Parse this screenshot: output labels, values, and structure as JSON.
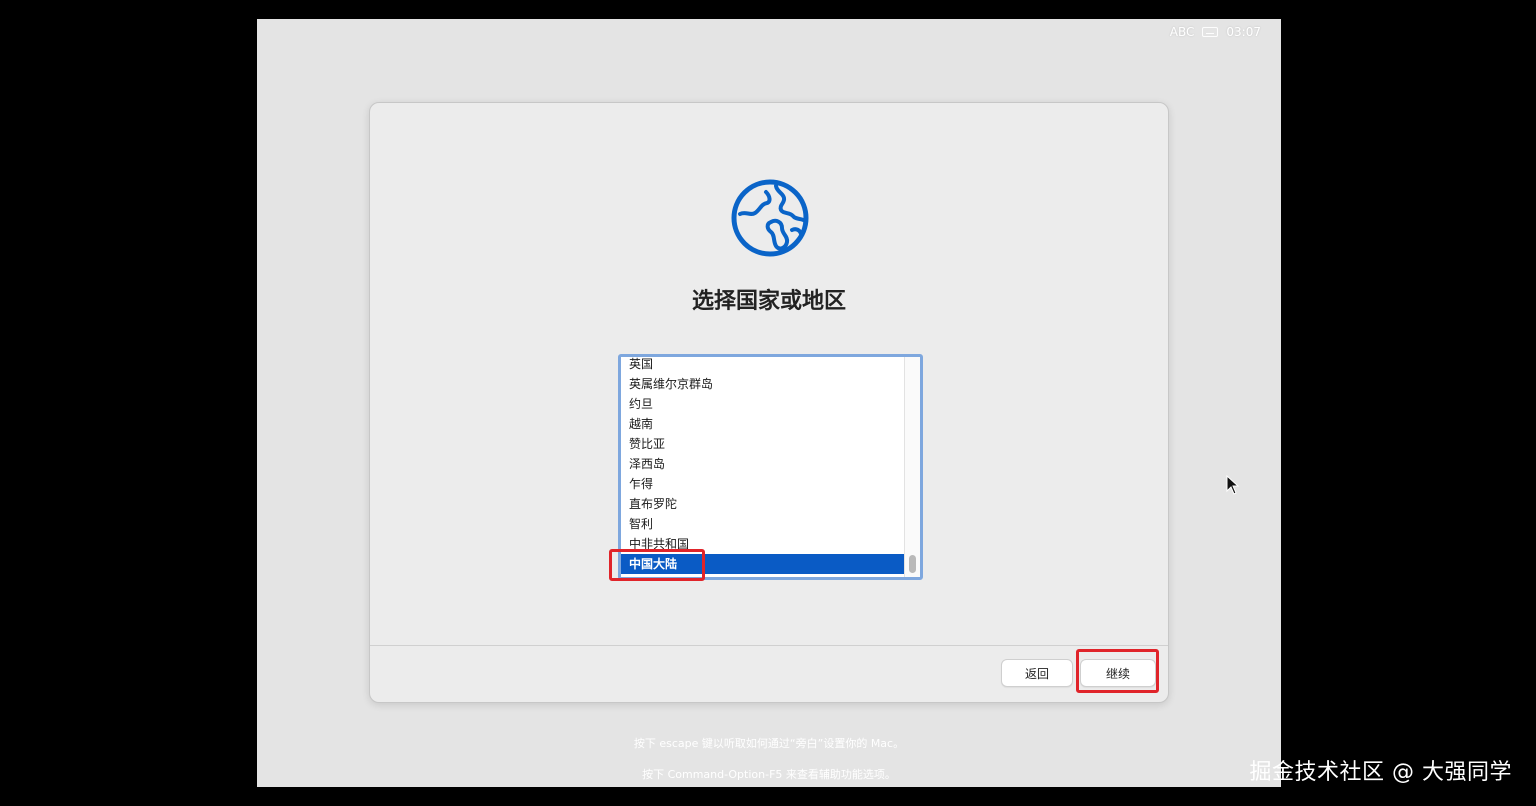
{
  "status_bar": {
    "input_method": "ABC",
    "keyboard_icon": "keyboard-icon",
    "time": "03:07"
  },
  "setup": {
    "icon": "globe-icon",
    "title": "选择国家或地区",
    "countries": [
      "英国",
      "英属维尔京群岛",
      "约旦",
      "越南",
      "赞比亚",
      "泽西岛",
      "乍得",
      "直布罗陀",
      "智利",
      "中非共和国",
      "中国大陆"
    ],
    "selected": "中国大陆",
    "back_label": "返回",
    "continue_label": "继续"
  },
  "hints": {
    "line1": "按下 escape 键以听取如何通过“旁白”设置你的 Mac。",
    "line2": "按下 Command-Option-F5 来查看辅助功能选项。"
  },
  "watermark": "掘金技术社区 @ 大强同学",
  "colors": {
    "selection": "#0a5bc5",
    "accent_icon": "#0a64c8",
    "annotation_red": "#e0242a",
    "list_focus_ring": "#7ea7de"
  }
}
